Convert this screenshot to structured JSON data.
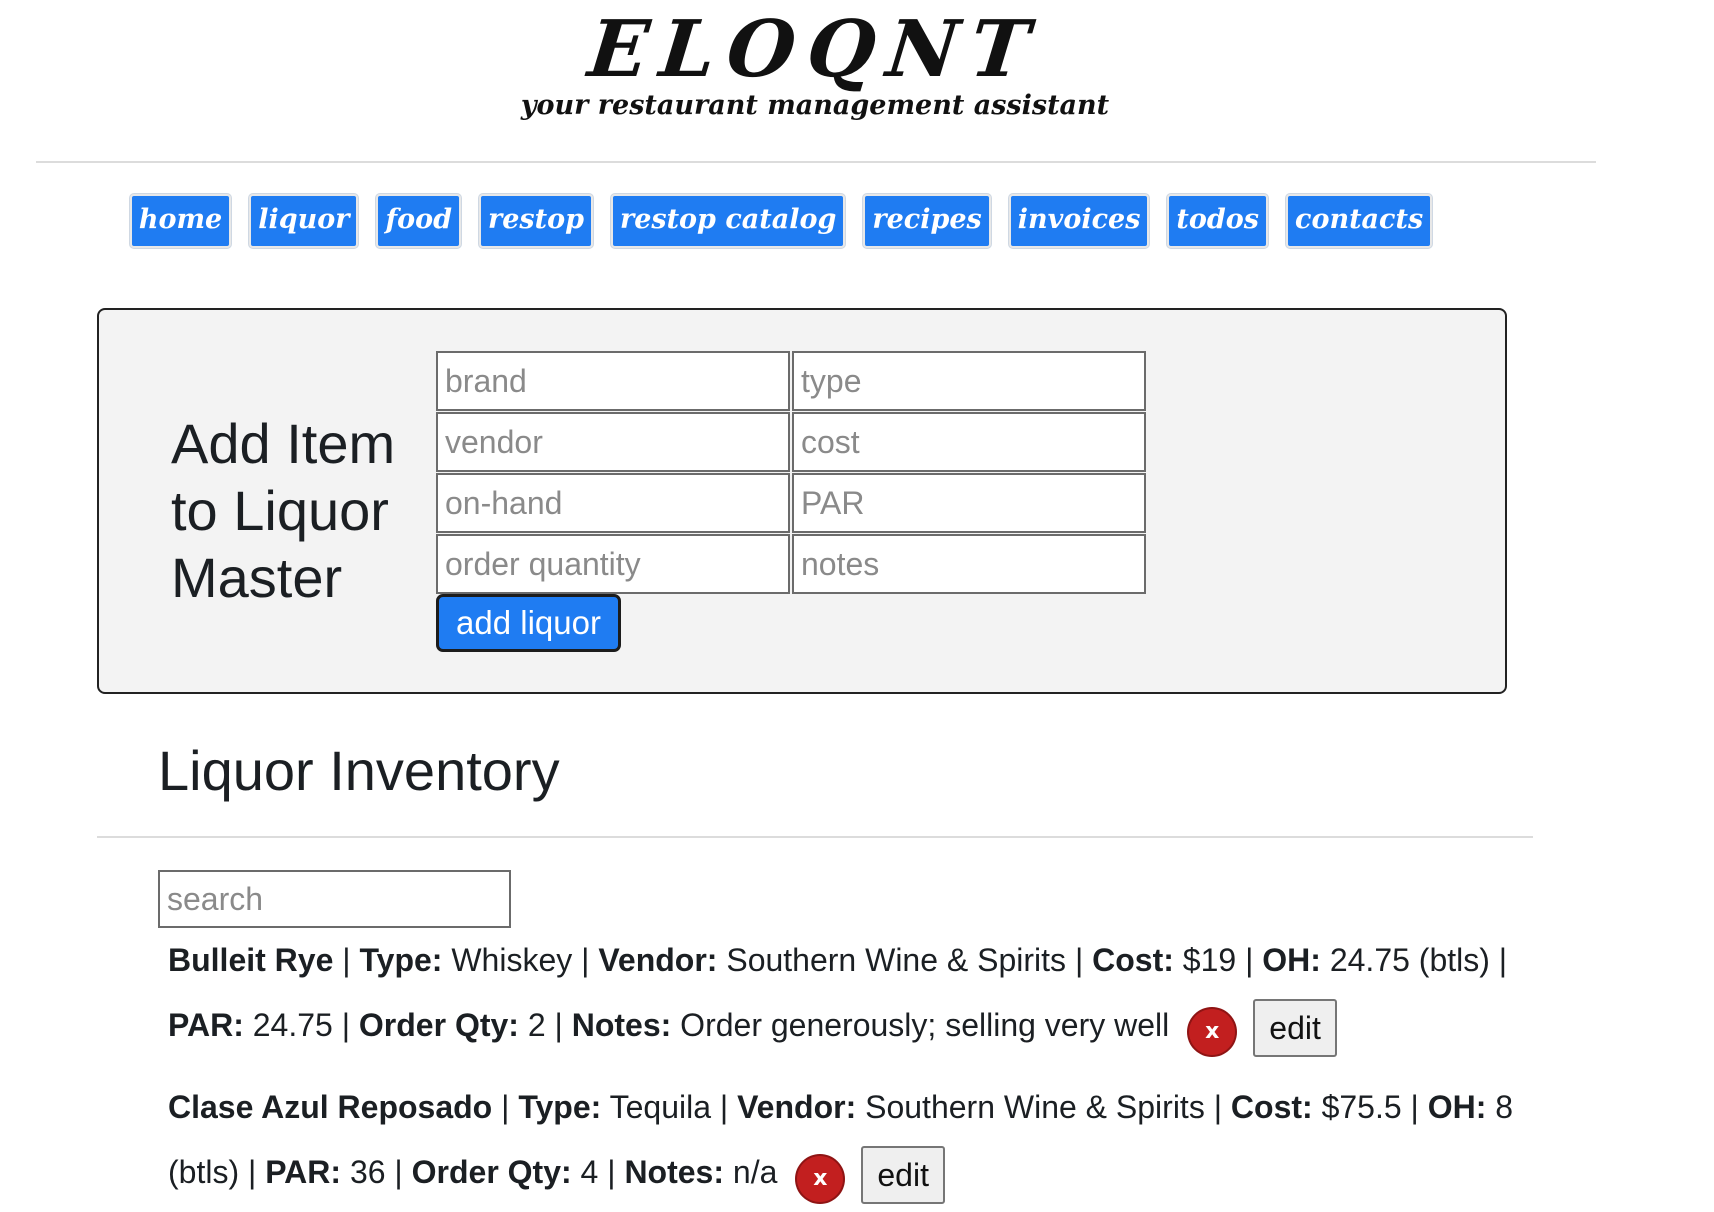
{
  "brand": {
    "logo": "ELOQNT",
    "tagline": "your restaurant management assistant"
  },
  "nav": {
    "items": [
      "home",
      "liquor",
      "food",
      "restop",
      "restop catalog",
      "recipes",
      "invoices",
      "todos",
      "contacts"
    ]
  },
  "add_form": {
    "title": "Add Item to Liquor Master",
    "placeholders": {
      "brand": "brand",
      "type": "type",
      "vendor": "vendor",
      "cost": "cost",
      "on_hand": "on-hand",
      "par": "PAR",
      "order_quantity": "order quantity",
      "notes": "notes"
    },
    "submit_label": "add liquor"
  },
  "inventory": {
    "title": "Liquor Inventory",
    "search_placeholder": "search",
    "labels": {
      "type": "Type:",
      "vendor": "Vendor:",
      "cost": "Cost:",
      "oh": "OH:",
      "par": "PAR:",
      "order_qty": "Order Qty:",
      "notes": "Notes:",
      "sep": "|",
      "delete": "x",
      "edit": "edit"
    },
    "items": [
      {
        "name": "Bulleit Rye",
        "type": "Whiskey",
        "vendor": "Southern Wine & Spirits",
        "cost": "$19",
        "oh": "24.75",
        "oh_unit": "(btls)",
        "par": "24.75",
        "order_qty": "2",
        "notes": "Order generously; selling very well"
      },
      {
        "name": "Clase Azul Reposado",
        "type": "Tequila",
        "vendor": "Southern Wine & Spirits",
        "cost": "$75.5",
        "oh": "8",
        "oh_unit": "(btls)",
        "par": "36",
        "order_qty": "4",
        "notes": "n/a"
      }
    ]
  },
  "colors": {
    "primary": "#1f7cf2",
    "danger": "#c21f1f",
    "card_bg": "#f3f3f3"
  }
}
